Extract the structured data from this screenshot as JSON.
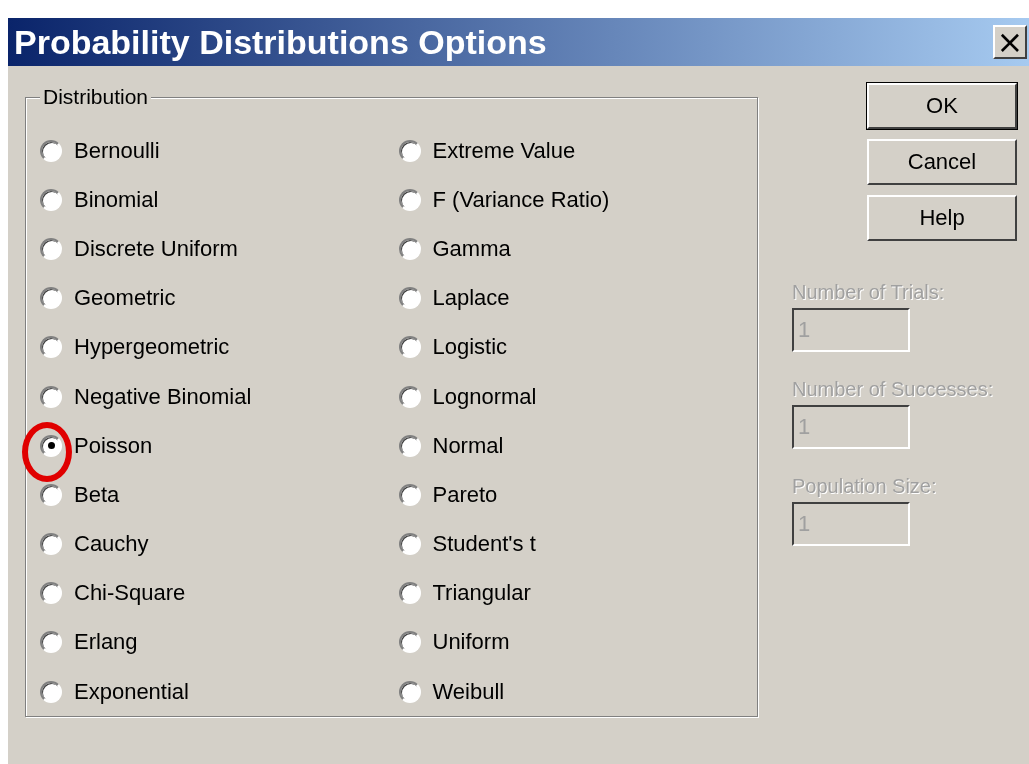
{
  "window": {
    "title": "Probability Distributions Options",
    "close": "×"
  },
  "group": {
    "label": "Distribution",
    "columns": [
      [
        {
          "label": "Bernoulli",
          "selected": false,
          "highlighted": false
        },
        {
          "label": "Binomial",
          "selected": false,
          "highlighted": false
        },
        {
          "label": "Discrete Uniform",
          "selected": false,
          "highlighted": false
        },
        {
          "label": "Geometric",
          "selected": false,
          "highlighted": false
        },
        {
          "label": "Hypergeometric",
          "selected": false,
          "highlighted": false
        },
        {
          "label": "Negative Binomial",
          "selected": false,
          "highlighted": false
        },
        {
          "label": "Poisson",
          "selected": true,
          "highlighted": true
        },
        {
          "label": "Beta",
          "selected": false,
          "highlighted": false
        },
        {
          "label": "Cauchy",
          "selected": false,
          "highlighted": false
        },
        {
          "label": "Chi-Square",
          "selected": false,
          "highlighted": false
        },
        {
          "label": "Erlang",
          "selected": false,
          "highlighted": false
        },
        {
          "label": "Exponential",
          "selected": false,
          "highlighted": false
        }
      ],
      [
        {
          "label": "Extreme Value",
          "selected": false,
          "highlighted": false
        },
        {
          "label": "F (Variance Ratio)",
          "selected": false,
          "highlighted": false
        },
        {
          "label": "Gamma",
          "selected": false,
          "highlighted": false
        },
        {
          "label": "Laplace",
          "selected": false,
          "highlighted": false
        },
        {
          "label": "Logistic",
          "selected": false,
          "highlighted": false
        },
        {
          "label": "Lognormal",
          "selected": false,
          "highlighted": false
        },
        {
          "label": "Normal",
          "selected": false,
          "highlighted": false
        },
        {
          "label": "Pareto",
          "selected": false,
          "highlighted": false
        },
        {
          "label": "Student's t",
          "selected": false,
          "highlighted": false
        },
        {
          "label": "Triangular",
          "selected": false,
          "highlighted": false
        },
        {
          "label": "Uniform",
          "selected": false,
          "highlighted": false
        },
        {
          "label": "Weibull",
          "selected": false,
          "highlighted": false
        }
      ]
    ]
  },
  "buttons": [
    {
      "label": "OK",
      "default": true
    },
    {
      "label": "Cancel",
      "default": false
    },
    {
      "label": "Help",
      "default": false
    }
  ],
  "fields": [
    {
      "label": "Number of Trials:",
      "value": "1",
      "disabled": true
    },
    {
      "label": "Number of Successes:",
      "value": "1",
      "disabled": true
    },
    {
      "label": "Population Size:",
      "value": "1",
      "disabled": true
    }
  ]
}
